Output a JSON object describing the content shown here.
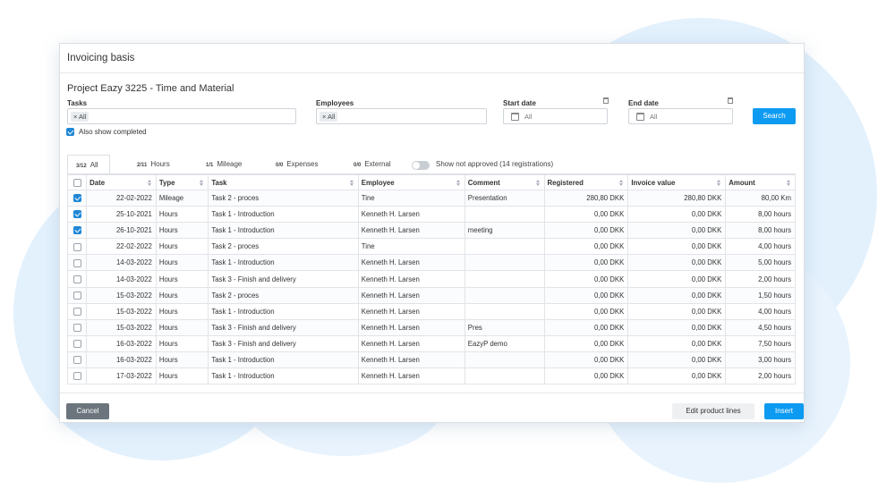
{
  "dialog": {
    "title": "Invoicing basis",
    "project_title": "Project Eazy 3225 - Time and Material"
  },
  "filters": {
    "tasks_label": "Tasks",
    "tasks_chip": "× All",
    "employees_label": "Employees",
    "employees_chip": "× All",
    "start_date_label": "Start date",
    "start_date_value": "All",
    "end_date_label": "End date",
    "end_date_value": "All",
    "search_label": "Search",
    "also_show_completed": "Also show completed",
    "also_show_completed_checked": true
  },
  "tabs": [
    {
      "count": "3/12",
      "label": "All",
      "active": true
    },
    {
      "count": "2/11",
      "label": "Hours"
    },
    {
      "count": "1/1",
      "label": "Mileage"
    },
    {
      "count": "0/0",
      "label": "Expenses"
    },
    {
      "count": "0/0",
      "label": "External"
    }
  ],
  "show_not_approved": "Show not approved (14 registrations)",
  "table": {
    "headers": [
      "Date",
      "Type",
      "Task",
      "Employee",
      "Comment",
      "Registered",
      "Invoice value",
      "Amount"
    ],
    "rows": [
      {
        "checked": true,
        "date": "22-02-2022",
        "type": "Mileage",
        "task": "Task 2 - proces",
        "employee": "Tine",
        "comment": "Presentation",
        "registered": "280,80 DKK",
        "invoice_value": "280,80 DKK",
        "amount": "80,00 Km"
      },
      {
        "checked": true,
        "date": "25-10-2021",
        "type": "Hours",
        "task": "Task 1 - Introduction",
        "employee": "Kenneth H. Larsen",
        "comment": "",
        "registered": "0,00 DKK",
        "invoice_value": "0,00 DKK",
        "amount": "8,00 hours"
      },
      {
        "checked": true,
        "date": "26-10-2021",
        "type": "Hours",
        "task": "Task 1 - Introduction",
        "employee": "Kenneth H. Larsen",
        "comment": "meeting",
        "registered": "0,00 DKK",
        "invoice_value": "0,00 DKK",
        "amount": "8,00 hours"
      },
      {
        "checked": false,
        "date": "22-02-2022",
        "type": "Hours",
        "task": "Task 2 - proces",
        "employee": "Tine",
        "comment": "",
        "registered": "0,00 DKK",
        "invoice_value": "0,00 DKK",
        "amount": "4,00 hours"
      },
      {
        "checked": false,
        "date": "14-03-2022",
        "type": "Hours",
        "task": "Task 1 - Introduction",
        "employee": "Kenneth H. Larsen",
        "comment": "",
        "registered": "0,00 DKK",
        "invoice_value": "0,00 DKK",
        "amount": "5,00 hours"
      },
      {
        "checked": false,
        "date": "14-03-2022",
        "type": "Hours",
        "task": "Task 3 - Finish and delivery",
        "employee": "Kenneth H. Larsen",
        "comment": "",
        "registered": "0,00 DKK",
        "invoice_value": "0,00 DKK",
        "amount": "2,00 hours"
      },
      {
        "checked": false,
        "date": "15-03-2022",
        "type": "Hours",
        "task": "Task 2 - proces",
        "employee": "Kenneth H. Larsen",
        "comment": "",
        "registered": "0,00 DKK",
        "invoice_value": "0,00 DKK",
        "amount": "1,50 hours"
      },
      {
        "checked": false,
        "date": "15-03-2022",
        "type": "Hours",
        "task": "Task 1 - Introduction",
        "employee": "Kenneth H. Larsen",
        "comment": "",
        "registered": "0,00 DKK",
        "invoice_value": "0,00 DKK",
        "amount": "4,00 hours"
      },
      {
        "checked": false,
        "date": "15-03-2022",
        "type": "Hours",
        "task": "Task 3 - Finish and delivery",
        "employee": "Kenneth H. Larsen",
        "comment": "Pres",
        "registered": "0,00 DKK",
        "invoice_value": "0,00 DKK",
        "amount": "4,50 hours"
      },
      {
        "checked": false,
        "date": "16-03-2022",
        "type": "Hours",
        "task": "Task 3 - Finish and delivery",
        "employee": "Kenneth H. Larsen",
        "comment": "EazyP demo",
        "registered": "0,00 DKK",
        "invoice_value": "0,00 DKK",
        "amount": "7,50 hours"
      },
      {
        "checked": false,
        "date": "16-03-2022",
        "type": "Hours",
        "task": "Task 1 - Introduction",
        "employee": "Kenneth H. Larsen",
        "comment": "",
        "registered": "0,00 DKK",
        "invoice_value": "0,00 DKK",
        "amount": "3,00 hours"
      },
      {
        "checked": false,
        "date": "17-03-2022",
        "type": "Hours",
        "task": "Task 1 - Introduction",
        "employee": "Kenneth H. Larsen",
        "comment": "",
        "registered": "0,00 DKK",
        "invoice_value": "0,00 DKK",
        "amount": "2,00 hours"
      }
    ]
  },
  "footer": {
    "cancel_label": "Cancel",
    "edit_label": "Edit product lines",
    "insert_label": "Insert"
  },
  "colors": {
    "primary": "#0d9bf2",
    "checkbox": "#1e87d6",
    "cancel": "#6c757d",
    "background_circles": "#e3f1fd"
  }
}
